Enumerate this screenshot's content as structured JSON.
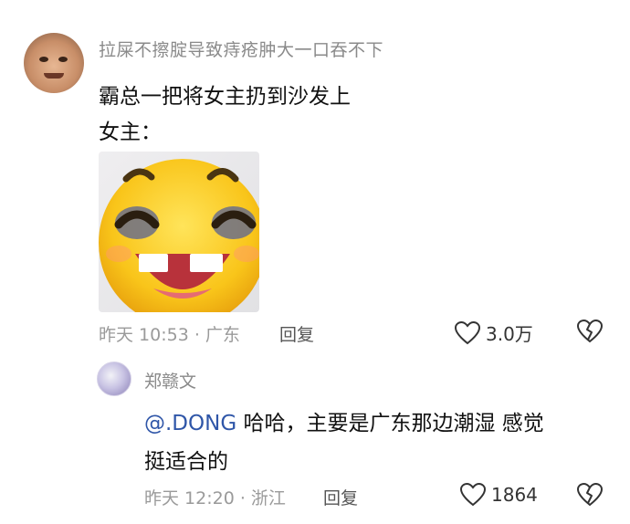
{
  "comment": {
    "username": "拉屎不擦腚导致痔疮肿大一口吞不下",
    "line1": "霸总一把将女主扔到沙发上",
    "line2": "女主：",
    "image_icon": "laughing-emoji-sticker",
    "meta": "昨天 10:53 · 广东",
    "reply_label": "回复",
    "like_count": "3.0万"
  },
  "reply": {
    "username": "郑赣文",
    "mention": "@.DONG",
    "text_line1": " 哈哈，主要是广东那边潮湿 感觉",
    "text_line2": "挺适合的",
    "meta": "昨天 12:20 · 浙江",
    "reply_label": "回复",
    "like_count": "1864"
  },
  "icons": {
    "like": "heart-outline-icon",
    "dislike": "broken-heart-icon"
  }
}
